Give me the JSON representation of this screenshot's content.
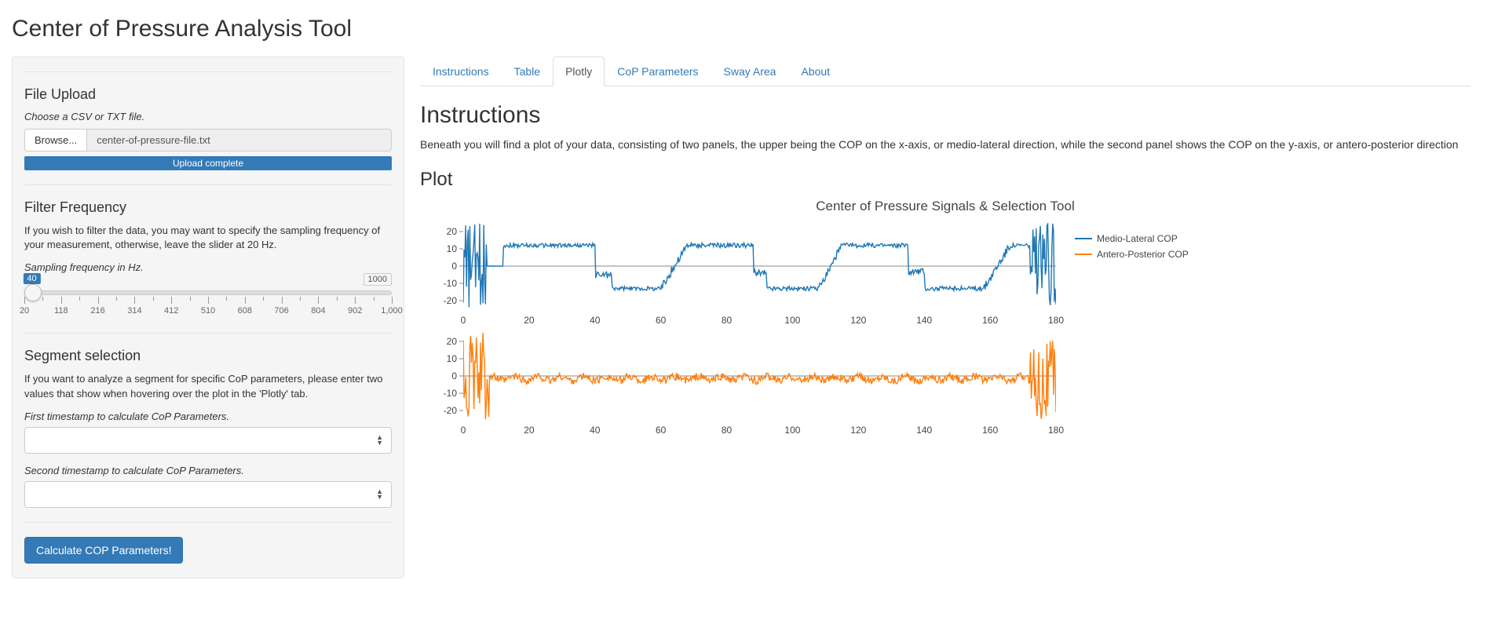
{
  "page_title": "Center of Pressure Analysis Tool",
  "sidebar": {
    "file_upload": {
      "heading": "File Upload",
      "help": "Choose a CSV or TXT file.",
      "browse_label": "Browse...",
      "filename": "center-of-pressure-file.txt",
      "progress_text": "Upload complete"
    },
    "filter": {
      "heading": "Filter Frequency",
      "help": "If you wish to filter the data, you may want to specify the sampling frequency of your measurement, otherwise, leave the slider at 20 Hz.",
      "slider_label": "Sampling frequency in Hz.",
      "value": 40,
      "min": 20,
      "max": 1000,
      "ticks": [
        20,
        118,
        216,
        314,
        412,
        510,
        608,
        706,
        804,
        902,
        1000
      ]
    },
    "segment": {
      "heading": "Segment selection",
      "help": "If you want to analyze a segment for specific CoP parameters, please enter two values that show when hovering over the plot in the 'Plotly' tab.",
      "first_label": "First timestamp to calculate CoP Parameters.",
      "second_label": "Second timestamp to calculate CoP Parameters.",
      "first_value": "",
      "second_value": ""
    },
    "button_label": "Calculate COP Parameters!"
  },
  "tabs": [
    {
      "id": "instructions",
      "label": "Instructions"
    },
    {
      "id": "table",
      "label": "Table"
    },
    {
      "id": "plotly",
      "label": "Plotly"
    },
    {
      "id": "cop-params",
      "label": "CoP Parameters"
    },
    {
      "id": "sway",
      "label": "Sway Area"
    },
    {
      "id": "about",
      "label": "About"
    }
  ],
  "active_tab": "plotly",
  "content": {
    "instructions_heading": "Instructions",
    "instructions_body": "Beneath you will find a plot of your data, consisting of two panels, the upper being the COP on the x-axis, or medio-lateral direction, while the second panel shows the COP on the y-axis, or antero-posterior direction",
    "plot_heading": "Plot"
  },
  "chart_data": {
    "type": "line",
    "title": "Center of Pressure Signals & Selection Tool",
    "x_range": [
      0,
      180
    ],
    "x_ticks": [
      0,
      20,
      40,
      60,
      80,
      100,
      120,
      140,
      160,
      180
    ],
    "panels": [
      {
        "name": "Medio-Lateral COP",
        "color": "#1f77b4",
        "y_range": [
          -25,
          25
        ],
        "y_ticks": [
          -20,
          -10,
          0,
          10,
          20
        ],
        "segments": [
          {
            "range": [
              0,
              7
            ],
            "pattern": "noise",
            "amp": 25
          },
          {
            "range": [
              7,
              12
            ],
            "pattern": "flat",
            "level": 0
          },
          {
            "range": [
              12,
              40
            ],
            "pattern": "plateau",
            "level": 12,
            "jitter": 1.2
          },
          {
            "range": [
              40,
              45
            ],
            "pattern": "dip",
            "level": -5
          },
          {
            "range": [
              45,
              60
            ],
            "pattern": "plateau",
            "level": -13,
            "jitter": 1.2
          },
          {
            "range": [
              60,
              68
            ],
            "pattern": "trans",
            "from": -13,
            "to": 12
          },
          {
            "range": [
              68,
              88
            ],
            "pattern": "plateau",
            "level": 12,
            "jitter": 1.4
          },
          {
            "range": [
              88,
              92
            ],
            "pattern": "dip",
            "level": -4
          },
          {
            "range": [
              92,
              108
            ],
            "pattern": "plateau",
            "level": -13,
            "jitter": 1.3
          },
          {
            "range": [
              108,
              115
            ],
            "pattern": "trans",
            "from": -13,
            "to": 12
          },
          {
            "range": [
              115,
              135
            ],
            "pattern": "plateau",
            "level": 12,
            "jitter": 1.3
          },
          {
            "range": [
              135,
              140
            ],
            "pattern": "dip",
            "level": -3
          },
          {
            "range": [
              140,
              158
            ],
            "pattern": "plateau",
            "level": -13,
            "jitter": 1.3
          },
          {
            "range": [
              158,
              166
            ],
            "pattern": "trans",
            "from": -13,
            "to": 12
          },
          {
            "range": [
              166,
              172
            ],
            "pattern": "plateau",
            "level": 12,
            "jitter": 1.3
          },
          {
            "range": [
              172,
              180
            ],
            "pattern": "noise",
            "amp": 25
          }
        ]
      },
      {
        "name": "Antero-Posterior COP",
        "color": "#ff7f0e",
        "y_range": [
          -25,
          25
        ],
        "y_ticks": [
          -20,
          -10,
          0,
          10,
          20
        ],
        "segments": [
          {
            "range": [
              0,
              8
            ],
            "pattern": "noise",
            "amp": 25
          },
          {
            "range": [
              8,
              172
            ],
            "pattern": "wavy",
            "level": -1.5,
            "jitter": 2.2
          },
          {
            "range": [
              172,
              180
            ],
            "pattern": "noise",
            "amp": 25
          }
        ]
      }
    ],
    "legend": [
      "Medio-Lateral COP",
      "Antero-Posterior COP"
    ]
  }
}
